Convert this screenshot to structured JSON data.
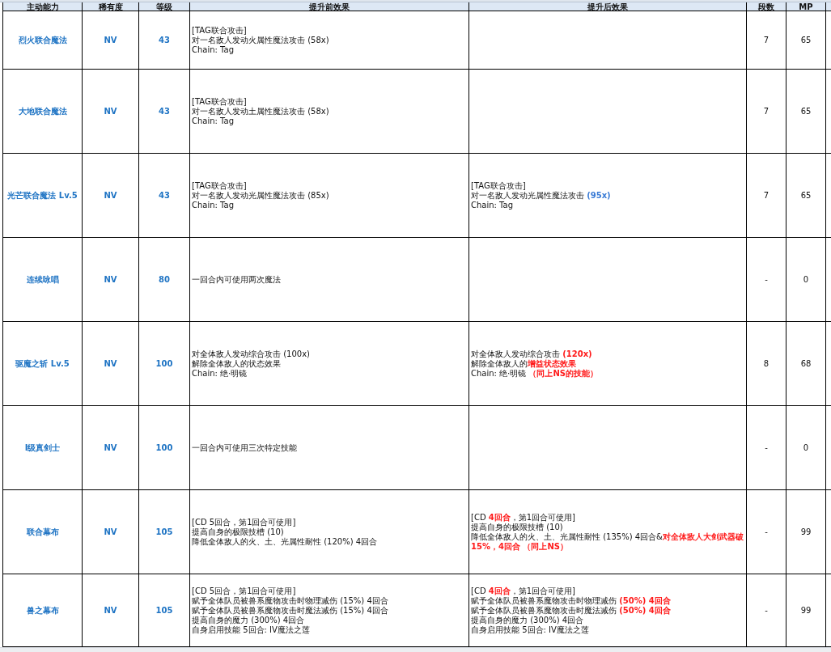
{
  "table": {
    "columns": [
      "主动能力",
      "稀有度",
      "等级",
      "提升前效果",
      "提升后效果",
      "段数",
      "MP"
    ],
    "rows": [
      {
        "name": "烈火联合魔法",
        "rarity": "NV",
        "level": "43",
        "before": [
          [
            {
              "text": "[TAG联合攻击]"
            }
          ],
          [
            {
              "text": "对一名敌人发动火属性魔法攻击 (58x)"
            }
          ],
          [
            {
              "text": "Chain: Tag"
            }
          ]
        ],
        "hits": "7",
        "mp": "65"
      },
      {
        "name": "大地联合魔法",
        "rarity": "NV",
        "level": "43",
        "before": [
          [
            {
              "text": "[TAG联合攻击]"
            }
          ],
          [
            {
              "text": "对一名敌人发动土属性魔法攻击 (58x)"
            }
          ],
          [
            {
              "text": "Chain: Tag"
            }
          ]
        ],
        "hits": "7",
        "mp": "65"
      },
      {
        "name": "光芒联合魔法 Lv.5",
        "rarity": "NV",
        "level": "43",
        "before": [
          [
            {
              "text": "[TAG联合攻击]"
            }
          ],
          [
            {
              "text": "对一名敌人发动光属性魔法攻击 (85x)"
            }
          ],
          [
            {
              "text": "Chain: Tag"
            }
          ]
        ],
        "after": [
          [
            {
              "text": "[TAG联合攻击]"
            }
          ],
          [
            {
              "text": "对一名敌人发动光属性魔法攻击 "
            },
            {
              "text": "(95x)",
              "color": "#3a7bd5"
            }
          ],
          [
            {
              "text": "Chain: Tag"
            }
          ]
        ],
        "hits": "7",
        "mp": "65"
      },
      {
        "name": "连续咏唱",
        "rarity": "NV",
        "level": "80",
        "before": [
          [
            {
              "text": "一回合内可使用两次魔法"
            }
          ]
        ],
        "hits": "-",
        "mp": "0"
      },
      {
        "name": "驱魔之斩 Lv.5",
        "rarity": "NV",
        "level": "100",
        "before": [
          [
            {
              "text": "对全体敌人发动综合攻击 (100x)"
            }
          ],
          [
            {
              "text": "解除全体敌人的状态效果"
            }
          ],
          [
            {
              "text": "Chain: 绝·明镜"
            }
          ]
        ],
        "after": [
          [
            {
              "text": "对全体敌人发动综合攻击 "
            },
            {
              "text": "(120x)",
              "color": "#ff1a1a"
            }
          ],
          [
            {
              "text": "解除全体敌人的"
            },
            {
              "text": "增益状态效果",
              "color": "#ff1a1a"
            }
          ],
          [
            {
              "text": "Chain: 绝·明镜    "
            },
            {
              "text": "（同上NS的技能）",
              "color": "#ff1a1a"
            }
          ]
        ],
        "hits": "8",
        "mp": "68"
      },
      {
        "name": "I级真剑士",
        "rarity": "NV",
        "level": "100",
        "before": [
          [
            {
              "text": "一回合内可使用三次特定技能"
            }
          ]
        ],
        "hits": "-",
        "mp": "0"
      },
      {
        "name": "联合幕布",
        "rarity": "NV",
        "level": "105",
        "before": [
          [
            {
              "text": "[CD 5回合，第1回合可使用]"
            }
          ],
          [
            {
              "text": "提高自身的极限技槽 (10)"
            }
          ],
          [
            {
              "text": "降低全体敌人的火、土、光属性耐性 (120%) 4回合"
            }
          ]
        ],
        "after": [
          [
            {
              "text": "[CD "
            },
            {
              "text": "4回合",
              "color": "#ff1a1a"
            },
            {
              "text": "，第1回合可使用]"
            }
          ],
          [
            {
              "text": "提高自身的极限技槽 (10)"
            }
          ],
          [
            {
              "text": "降低全体敌人的火、土、光属性耐性 (135%) 4回合&"
            },
            {
              "text": "对全体敌人大剑武器破15%，4回合    （同上NS）",
              "color": "#ff1a1a"
            }
          ]
        ],
        "hits": "-",
        "mp": "99"
      },
      {
        "name": "兽之幕布",
        "rarity": "NV",
        "level": "105",
        "before": [
          [
            {
              "text": "[CD 5回合，第1回合可使用]"
            }
          ],
          [
            {
              "text": "赋予全体队员被兽系魔物攻击时物理减伤 (15%) 4回合"
            }
          ],
          [
            {
              "text": "赋予全体队员被兽系魔物攻击时魔法减伤 (15%) 4回合"
            }
          ],
          [
            {
              "text": "提高自身的魔力 (300%) 4回合"
            }
          ],
          [
            {
              "text": "自身启用技能 5回合: IV魔法之莲"
            }
          ]
        ],
        "after": [
          [
            {
              "text": "[CD "
            },
            {
              "text": "4回合",
              "color": "#ff1a1a"
            },
            {
              "text": "，第1回合可使用]"
            }
          ],
          [
            {
              "text": "赋予全体队员被兽系魔物攻击时物理减伤 "
            },
            {
              "text": "(50%) 4回合",
              "color": "#ff1a1a"
            }
          ],
          [
            {
              "text": "赋予全体队员被兽系魔物攻击时魔法减伤 "
            },
            {
              "text": "(50%) 4回合",
              "color": "#ff1a1a"
            }
          ],
          [
            {
              "text": "提高自身的魔力 (300%) 4回合"
            }
          ],
          [
            {
              "text": "自身启用技能 5回合: IV魔法之莲"
            }
          ]
        ],
        "hits": "-",
        "mp": "99"
      }
    ]
  }
}
